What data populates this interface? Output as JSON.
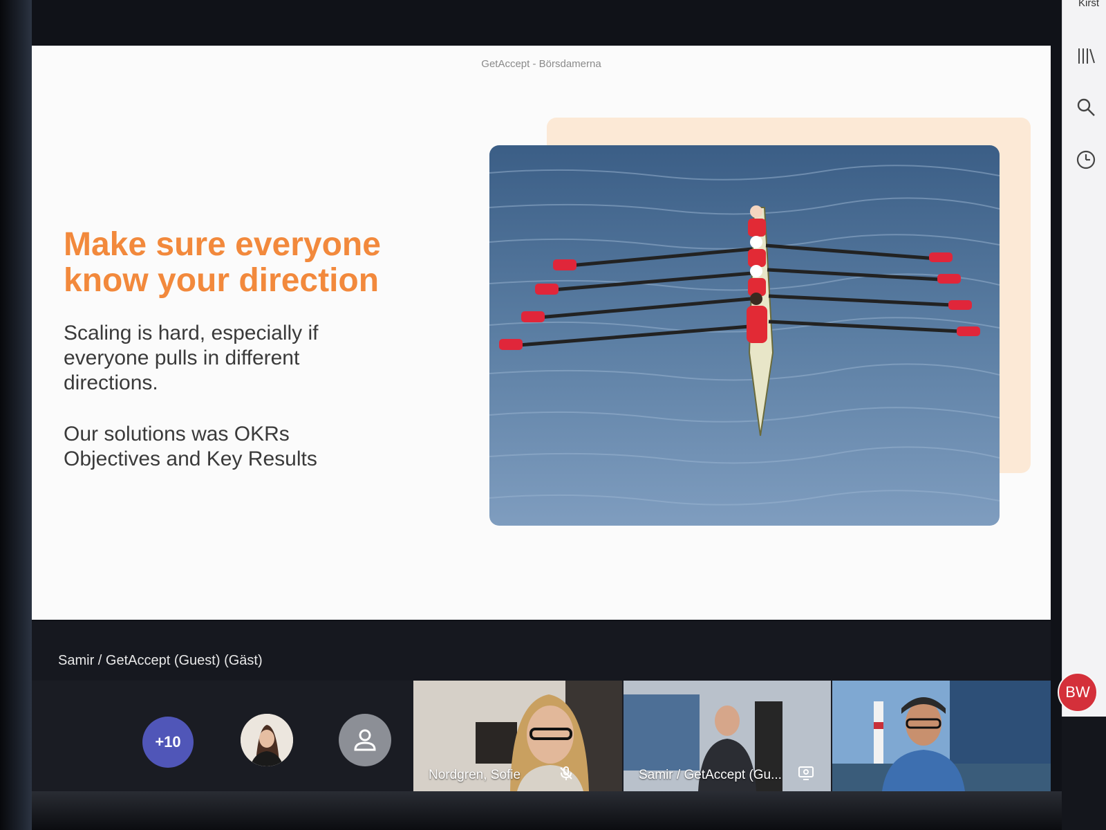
{
  "slide": {
    "caption": "GetAccept - Börsdamerna",
    "headline_line1": "Make sure everyone",
    "headline_line2": "know your direction",
    "para1_line1": "Scaling is hard, especially if",
    "para1_line2": "everyone pulls in different",
    "para1_line3": "directions.",
    "para2_line1": "Our solutions was OKRs",
    "para2_line2": "Objectives and Key Results",
    "accent_color": "#F2893C",
    "photo_icon": "rowing-boat-photo"
  },
  "presenter": {
    "name": "Samir / GetAccept (Guest) (Gäst)"
  },
  "participants": {
    "overflow_count": "+10",
    "tiles": [
      {
        "label": "Nordgren, Sofie",
        "icon": "mic-off-icon"
      },
      {
        "label": "Samir / GetAccept (Gu...",
        "icon": "screen-share-icon"
      },
      {
        "label": "",
        "icon": ""
      }
    ]
  },
  "right_rail": {
    "top_text": "Kirst",
    "icons": [
      "library-icon",
      "search-icon",
      "clock-icon"
    ],
    "user_initials": "BW",
    "user_color": "#D4303A"
  }
}
